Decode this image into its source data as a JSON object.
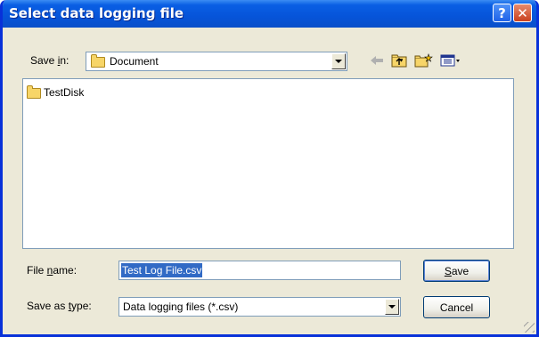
{
  "window": {
    "title": "Select data logging file"
  },
  "title_buttons": {
    "help": "?",
    "close": "✕"
  },
  "save_in": {
    "label_prefix": "Save ",
    "label_mnemonic": "i",
    "label_suffix": "n:",
    "value": "Document"
  },
  "toolbar": {
    "icons": [
      "back-arrow-icon",
      "up-folder-icon",
      "new-folder-icon",
      "view-menu-icon"
    ]
  },
  "file_list": {
    "items": [
      {
        "name": "TestDisk",
        "icon": "folder-icon"
      }
    ]
  },
  "file_name": {
    "label_prefix": "File ",
    "label_mnemonic": "n",
    "label_suffix": "ame:",
    "value": "Test Log File.csv"
  },
  "save_as_type": {
    "label_prefix": "Save as ",
    "label_mnemonic": "t",
    "label_suffix": "ype:",
    "value": "Data logging files (*.csv)"
  },
  "buttons": {
    "save_mnemonic": "S",
    "save_rest": "ave",
    "cancel": "Cancel"
  },
  "colors": {
    "titlebar": "#0a5fe4",
    "dialog_bg": "#ece9d8",
    "selection": "#316ac5",
    "close": "#c9411f"
  }
}
